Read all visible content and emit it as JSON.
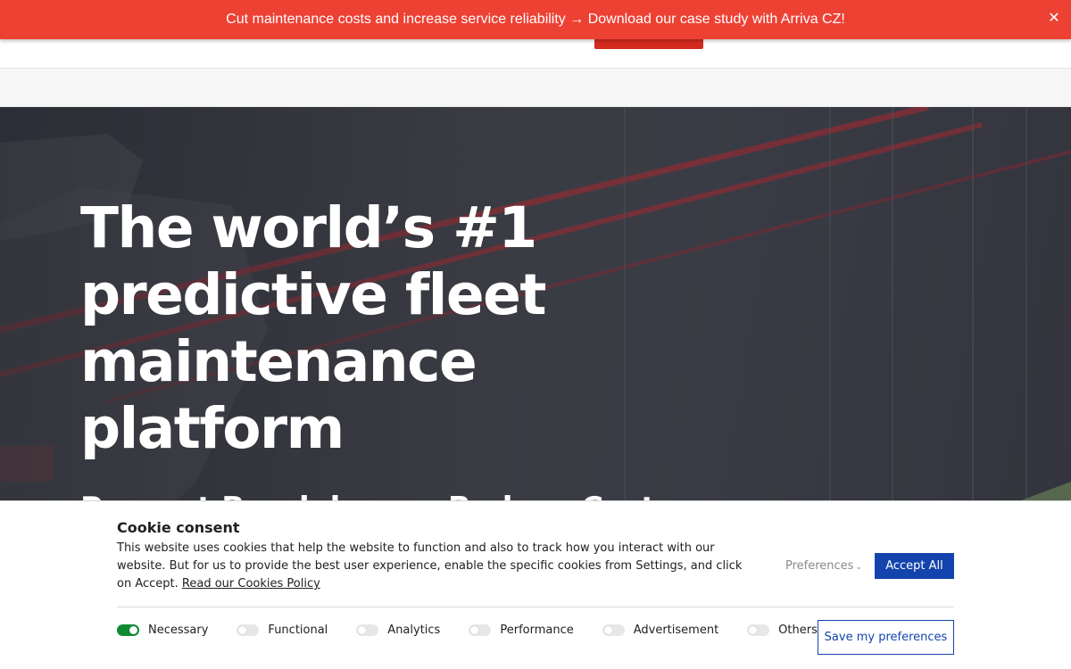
{
  "promo": {
    "text": "Cut maintenance costs and increase service reliability → Download our case study with Arriva CZ!",
    "close": "✕",
    "color": "#ed4134"
  },
  "header": {
    "logo_icon": "brand-logo",
    "cta_color": "#d32b1f"
  },
  "hero": {
    "title": "The world’s #1 predictive fleet maintenance platform",
    "subtitle": "Prevent Breakdowns. Reduce Costs."
  },
  "cookie": {
    "title": "Cookie consent",
    "text": "This website uses cookies that help the website to function and also to track how you interact with our website. But for us to provide the best user experience, enable the specific cookies from Settings, and click on Accept.",
    "link": "Read our Cookies Policy",
    "preferences": "Preferences",
    "accept": "Accept All",
    "save": "Save my preferences",
    "accent_color": "#1344ad",
    "toggles": [
      {
        "label": "Necessary",
        "on": true
      },
      {
        "label": "Functional",
        "on": false
      },
      {
        "label": "Analytics",
        "on": false
      },
      {
        "label": "Performance",
        "on": false
      },
      {
        "label": "Advertisement",
        "on": false
      },
      {
        "label": "Others",
        "on": false
      }
    ]
  }
}
